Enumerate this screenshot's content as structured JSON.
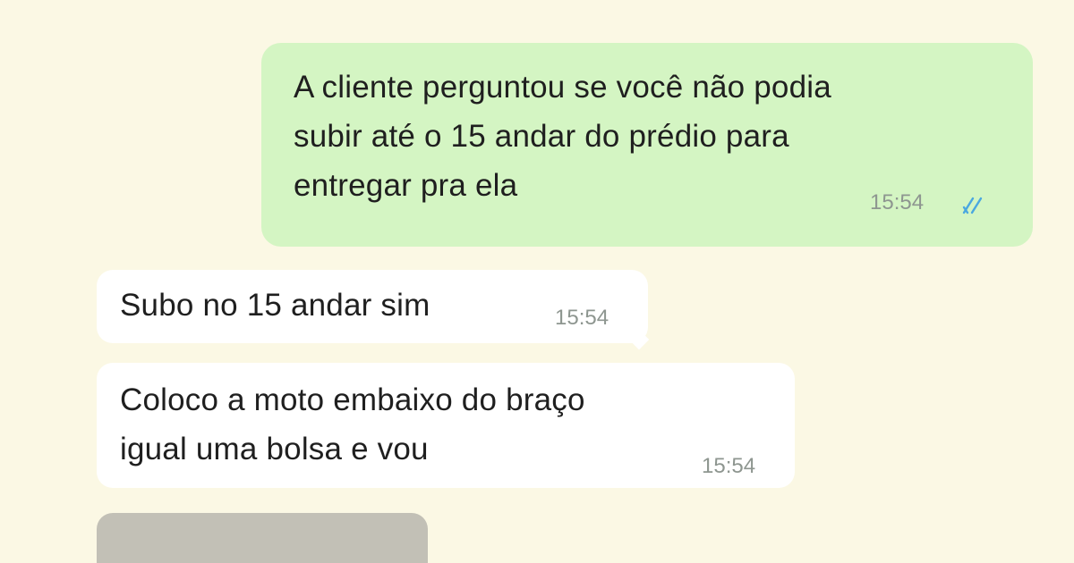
{
  "conversation": {
    "messages": [
      {
        "direction": "outgoing",
        "text": "A cliente perguntou se você não podia\nsubir até o 15 andar do prédio para\nentregar pra ela",
        "time": "15:54",
        "status_icon": "double-check-read-icon"
      },
      {
        "direction": "incoming",
        "text": "Subo no 15 andar sim",
        "time": "15:54"
      },
      {
        "direction": "incoming",
        "text": "Coloco a moto embaixo do braço\nigual uma bolsa e vou",
        "time": "15:54"
      }
    ],
    "media_preview": {
      "type": "image-thumbnail"
    }
  },
  "colors": {
    "background": "#fbf8e4",
    "outgoing_bubble": "#d4f5c3",
    "incoming_bubble": "#ffffff",
    "timestamp": "#8e9690",
    "read_ticks": "#4aa7e0"
  }
}
